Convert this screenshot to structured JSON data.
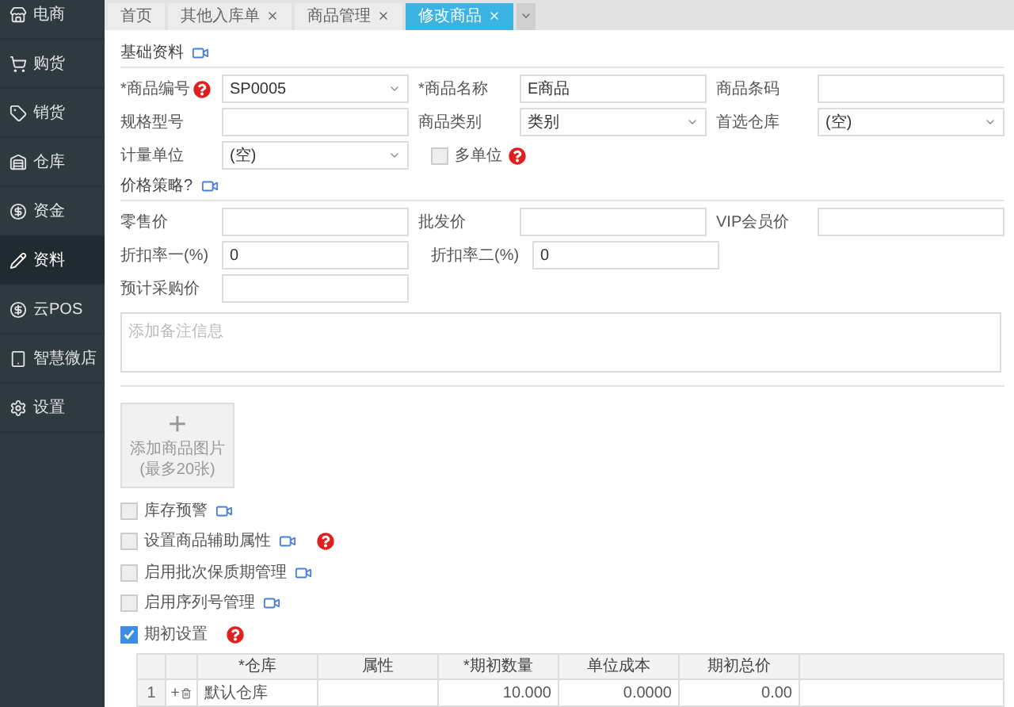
{
  "sidebar": {
    "items": [
      {
        "label": "电商",
        "selected": false
      },
      {
        "label": "购货",
        "selected": false
      },
      {
        "label": "销货",
        "selected": false
      },
      {
        "label": "仓库",
        "selected": false
      },
      {
        "label": "资金",
        "selected": false
      },
      {
        "label": "资料",
        "selected": true
      },
      {
        "label": "云POS",
        "selected": false
      },
      {
        "label": "智慧微店",
        "selected": false
      },
      {
        "label": "设置",
        "selected": false
      }
    ]
  },
  "tabs": [
    {
      "label": "首页",
      "closable": false,
      "selected": false
    },
    {
      "label": "其他入库单",
      "closable": true,
      "selected": false
    },
    {
      "label": "商品管理",
      "closable": true,
      "selected": false
    },
    {
      "label": "修改商品",
      "closable": true,
      "selected": true
    }
  ],
  "sections": [
    {
      "title": "基础资料",
      "rows": [
        [
          {
            "kind": "select",
            "label": "*商品编号",
            "help": true,
            "value": "SP0005"
          },
          {
            "kind": "input",
            "label": "*商品名称",
            "value": "E商品"
          },
          {
            "kind": "input",
            "label": "商品条码"
          }
        ],
        [
          {
            "kind": "input",
            "label": "规格型号"
          },
          {
            "kind": "select",
            "label": "商品类别",
            "value": "类别"
          },
          {
            "kind": "select",
            "label": "首选仓库",
            "value": "(空)"
          }
        ],
        [
          {
            "kind": "select",
            "label": "计量单位",
            "value": "(空)"
          },
          {
            "kind": "checkbox",
            "label": "多单位",
            "checked": false,
            "help": true
          }
        ]
      ]
    },
    {
      "title": "价格策略?",
      "rows": [
        [
          {
            "kind": "input",
            "label": "零售价"
          },
          {
            "kind": "input",
            "label": "批发价"
          },
          {
            "kind": "input",
            "label": "VIP会员价"
          }
        ],
        [
          {
            "kind": "input",
            "label": "折扣率一(%)",
            "value": "0"
          },
          {
            "kind": "input",
            "label": "折扣率二(%)",
            "value": "0"
          }
        ],
        [
          {
            "kind": "input",
            "label": "预计采购价"
          }
        ]
      ]
    }
  ],
  "remark": {
    "placeholder": "添加备注信息"
  },
  "image_upload": {
    "plus": "+",
    "label": "添加商品图片",
    "note": "(最多20张)"
  },
  "options": [
    {
      "label": "库存预警",
      "checked": false,
      "video": true,
      "help": false
    },
    {
      "label": "设置商品辅助属性",
      "checked": false,
      "video": true,
      "help": true
    },
    {
      "label": "启用批次保质期管理",
      "checked": false,
      "video": true,
      "help": false
    },
    {
      "label": "启用序列号管理",
      "checked": false,
      "video": true,
      "help": false
    },
    {
      "label": "期初设置",
      "checked": true,
      "video": false,
      "help": true
    }
  ],
  "table": {
    "columns": [
      "*仓库",
      "属性",
      "*期初数量",
      "单位成本",
      "期初总价"
    ],
    "rows": [
      {
        "index": "1",
        "add": "+",
        "cells": [
          "默认仓库",
          "",
          "10.000",
          "0.0000",
          "0.00"
        ]
      }
    ]
  }
}
